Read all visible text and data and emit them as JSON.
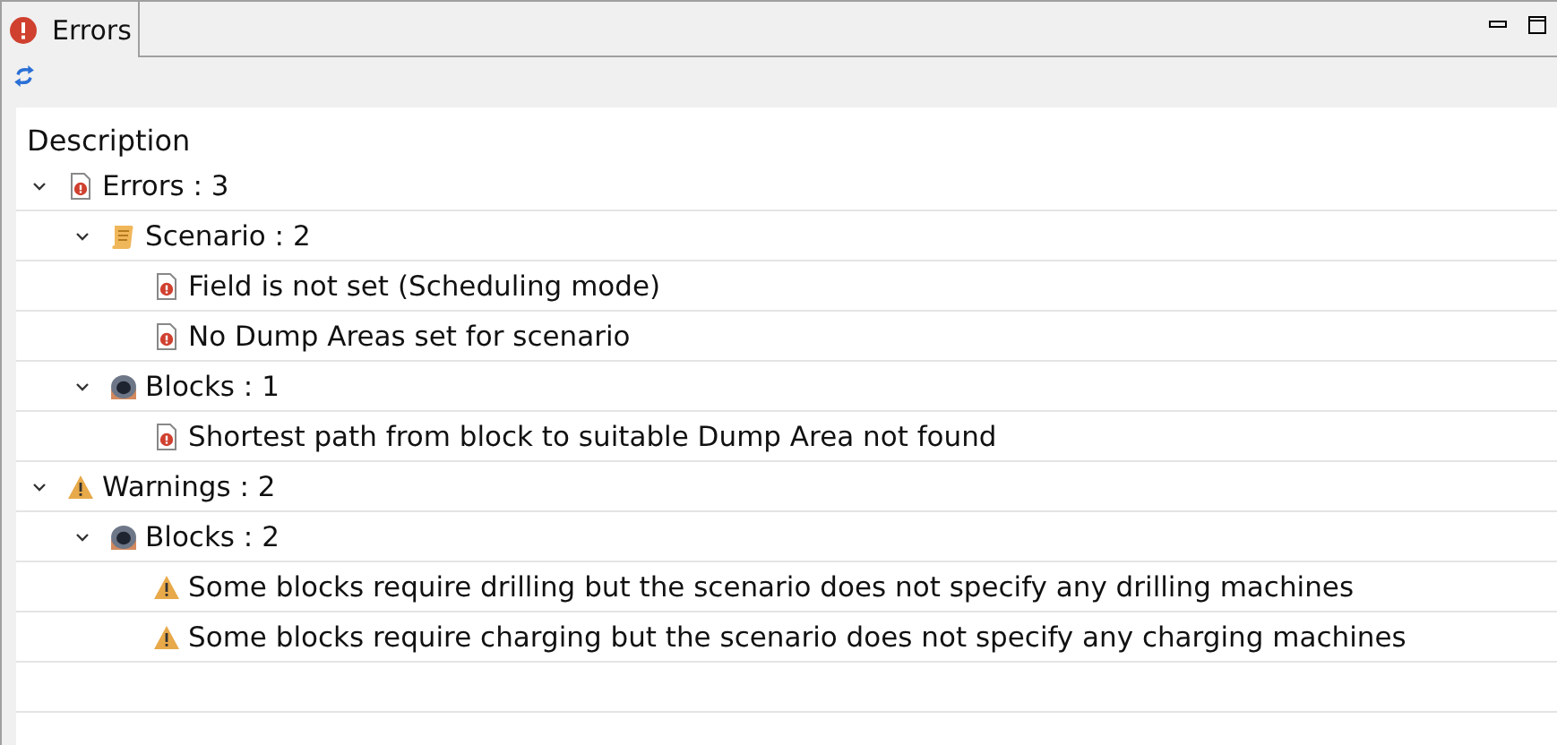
{
  "tab": {
    "title": "Errors",
    "selected": true
  },
  "table": {
    "columns": [
      "Description"
    ],
    "rows": [
      {
        "kind": "error",
        "label": "Errors : 3",
        "expanded": true,
        "children": [
          {
            "kind": "scenario",
            "label": "Scenario : 2",
            "expanded": true,
            "children": [
              {
                "kind": "error",
                "label": "Field is not set (Scheduling mode)"
              },
              {
                "kind": "error",
                "label": "No Dump Areas set for scenario"
              }
            ]
          },
          {
            "kind": "block",
            "label": "Blocks : 1",
            "expanded": true,
            "children": [
              {
                "kind": "error",
                "label": "Shortest path from block to suitable Dump Area not found"
              }
            ]
          }
        ]
      },
      {
        "kind": "warning",
        "label": "Warnings : 2",
        "expanded": true,
        "children": [
          {
            "kind": "block",
            "label": "Blocks : 2",
            "expanded": true,
            "children": [
              {
                "kind": "warning",
                "label": "Some blocks require drilling but the scenario does not specify any drilling machines"
              },
              {
                "kind": "warning",
                "label": "Some blocks require charging but the scenario does not specify any charging machines"
              }
            ]
          }
        ]
      }
    ]
  }
}
